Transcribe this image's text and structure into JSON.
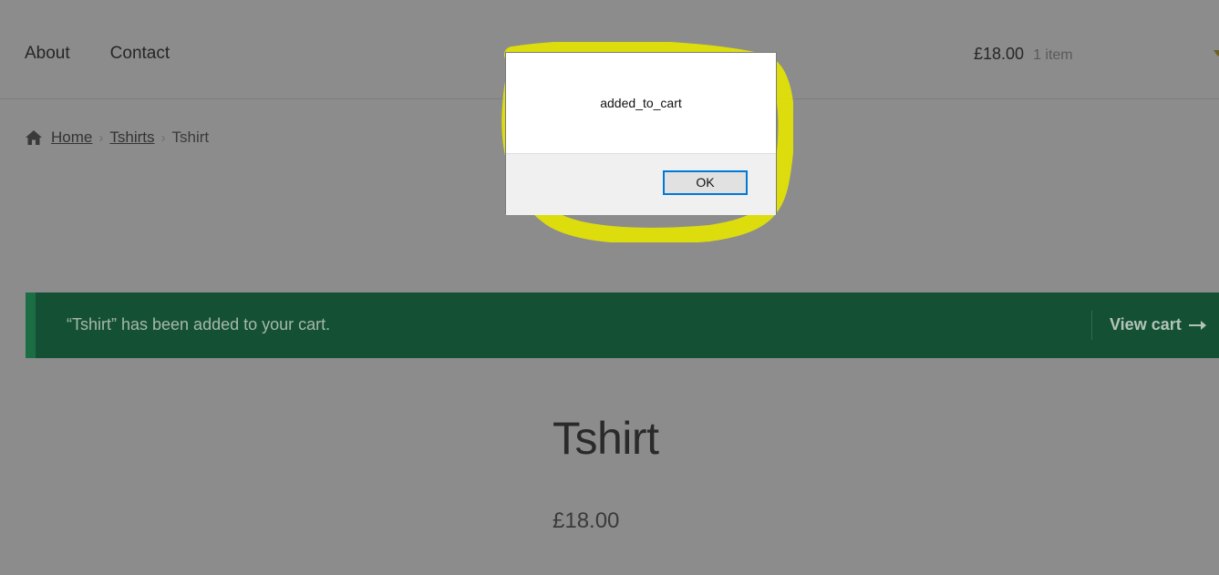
{
  "nav": {
    "items": [
      "About",
      "Contact"
    ]
  },
  "cart": {
    "total": "£18.00",
    "count": "1 item"
  },
  "breadcrumb": {
    "home": "Home",
    "category": "Tshirts",
    "current": "Tshirt",
    "separator": "›"
  },
  "notice": {
    "message": "“Tshirt” has been added to your cart.",
    "action": "View cart"
  },
  "product": {
    "title": "Tshirt",
    "price": "£18.00"
  },
  "dialog": {
    "message": "added_to_cart",
    "button": "OK"
  },
  "colors": {
    "page_overlay": "#8c8c8c",
    "notice_bg": "#145134",
    "notice_accent": "#1b6d44",
    "highlight": "#f0f000",
    "focus_border": "#0078d7"
  },
  "icons": {
    "home": "home-icon",
    "arrow": "arrow-right-icon",
    "caret": "caret-down-icon"
  }
}
